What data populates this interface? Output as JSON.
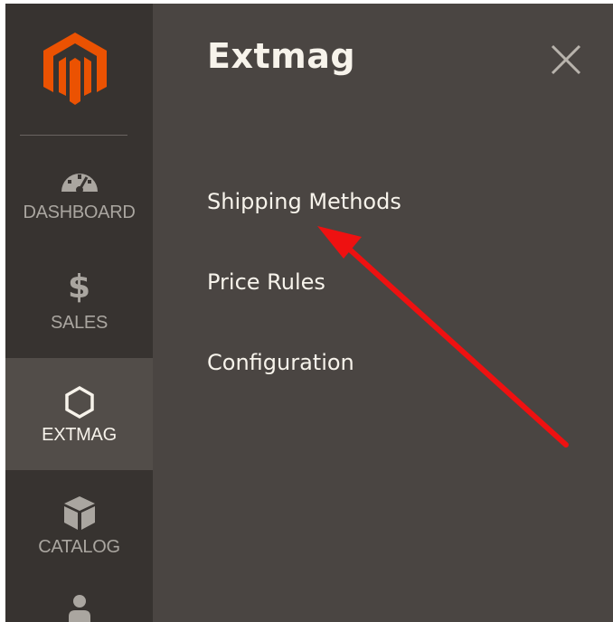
{
  "sidebar": {
    "items": [
      {
        "label": "DASHBOARD",
        "icon": "dashboard-gauge-icon"
      },
      {
        "label": "SALES",
        "icon": "dollar-icon",
        "glyph": "$"
      },
      {
        "label": "EXTMAG",
        "icon": "hexagon-icon",
        "active": true
      },
      {
        "label": "CATALOG",
        "icon": "box-icon"
      },
      {
        "label": "",
        "icon": "user-icon"
      }
    ]
  },
  "panel": {
    "title": "Extmag",
    "links": [
      {
        "label": "Shipping Methods"
      },
      {
        "label": "Price Rules"
      },
      {
        "label": "Configuration"
      }
    ]
  },
  "colors": {
    "sidebar_bg": "#373330",
    "panel_bg": "#4a4542",
    "active_item_bg": "#524d49",
    "logo_orange": "#eb5202",
    "annotation_red": "#ee1111"
  }
}
